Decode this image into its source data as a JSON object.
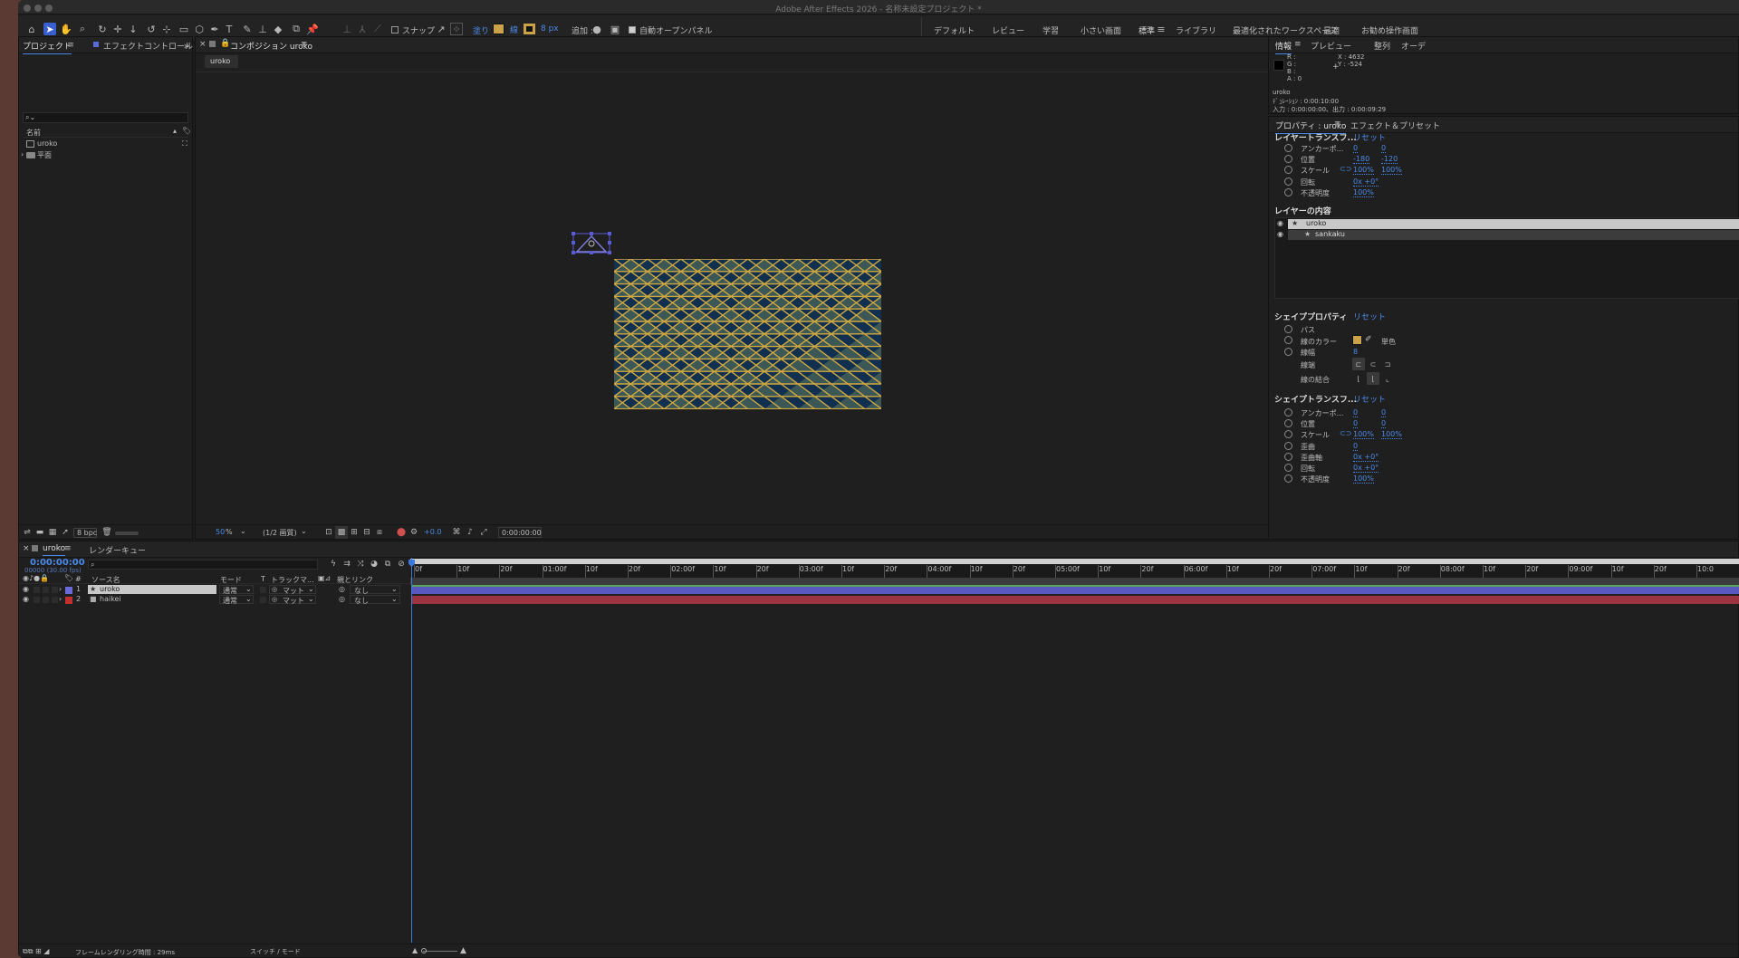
{
  "app_title": "Adobe After Effects 2026 - 名称未設定プロジェクト *",
  "toolbar": {
    "snap_label": "スナップ",
    "fill_label": "塗り",
    "stroke_width": "8 px",
    "add_label": "追加 :",
    "auto_open_label": "自動オープンパネル",
    "fill_color": "#c9a24a",
    "stroke_color": "#c9a24a"
  },
  "workspaces": [
    "デフォルト",
    "レビュー",
    "学習",
    "小さい画面",
    "標準",
    "ライブラリ",
    "最適化されたワークスペース",
    "最適",
    "お勧め操作画面"
  ],
  "project_panel": {
    "tab_project": "プロジェクト",
    "tab_effects": "エフェクトコントロール",
    "col_name": "名前",
    "items": [
      {
        "name": "uroko",
        "type": "composition"
      },
      {
        "name": "平面",
        "type": "folder"
      }
    ],
    "bpc": "8 bpc"
  },
  "comp_panel": {
    "tab_label": "コンポジション uroko",
    "breadcrumb": "uroko",
    "zoom": "50",
    "zoom_unit": "%",
    "resolution": "(1/2 画質)",
    "exposure": "+0.0",
    "timecode": "0:00:00:00",
    "pattern_bg": "#113050",
    "pattern_tri": "#3b5856",
    "pattern_line": "#d0a840"
  },
  "info_panel": {
    "tab_info": "情報",
    "tab_preview": "プレビュー",
    "tab_align": "整列",
    "tab_audio": "オーデ",
    "r": "R :",
    "g": "G :",
    "b": "B :",
    "a": "A : 0",
    "x": "X : 4632",
    "y": "Y : -524",
    "layer_name": "uroko",
    "duration": "ﾃﾞｭﾚｰｼｮﾝ : 0:00:10:00",
    "in_out": "入力 : 0:00:00:00、出力 : 0:00:09:29"
  },
  "properties_panel": {
    "tab_props": "プロパティ : uroko",
    "tab_effects": "エフェクト＆プリセット",
    "layer_transform": {
      "title": "レイヤートランスフ...",
      "reset": "リセット",
      "rows": [
        {
          "label": "アンカーポ...",
          "v1": "0",
          "v2": "0"
        },
        {
          "label": "位置",
          "v1": "-180",
          "v2": "-120"
        },
        {
          "label": "スケール",
          "v1": "100%",
          "v2": "100%"
        },
        {
          "label": "回転",
          "v1": "0x +0°",
          "v2": ""
        },
        {
          "label": "不透明度",
          "v1": "100%",
          "v2": ""
        }
      ]
    },
    "layer_contents": {
      "title": "レイヤーの内容",
      "items": [
        "uroko",
        "sankaku"
      ]
    },
    "shape_props": {
      "title": "シェイププロパティ",
      "reset": "リセット",
      "path": "パス",
      "stroke_color": "線のカラー",
      "stroke_mode": "単色",
      "stroke_width": "線幅",
      "stroke_width_val": "8",
      "line_cap": "線端",
      "line_join": "線の結合"
    },
    "shape_transform": {
      "title": "シェイプトランスフ...",
      "reset": "リセット",
      "rows": [
        {
          "label": "アンカーポ...",
          "v1": "0",
          "v2": "0"
        },
        {
          "label": "位置",
          "v1": "0",
          "v2": "0"
        },
        {
          "label": "スケール",
          "v1": "100%",
          "v2": "100%"
        },
        {
          "label": "歪曲",
          "v1": "0",
          "v2": ""
        },
        {
          "label": "歪曲軸",
          "v1": "0x +0°",
          "v2": ""
        },
        {
          "label": "回転",
          "v1": "0x +0°",
          "v2": ""
        },
        {
          "label": "不透明度",
          "v1": "100%",
          "v2": ""
        }
      ]
    }
  },
  "timeline": {
    "tab_comp": "uroko",
    "tab_render": "レンダーキュー",
    "timecode": "0:00:00:00",
    "frames": "00000 (30.00 fps)",
    "col_num": "#",
    "col_source": "ソース名",
    "col_mode": "モード",
    "col_t": "T",
    "col_track": "トラックマ...",
    "col_parent": "親とリンク",
    "layers": [
      {
        "num": "1",
        "name": "uroko",
        "mode": "通常",
        "matte": "マット",
        "parent": "なし",
        "color": "#6a6ad8"
      },
      {
        "num": "2",
        "name": "haikei",
        "mode": "通常",
        "matte": "マット",
        "parent": "なし",
        "color": "#c03030"
      }
    ],
    "ruler": [
      "0f",
      "10f",
      "20f",
      "01:00f",
      "10f",
      "20f",
      "02:00f",
      "10f",
      "20f",
      "03:00f",
      "10f",
      "20f",
      "04:00f",
      "10f",
      "20f",
      "05:00f",
      "10f",
      "20f",
      "06:00f",
      "10f",
      "20f",
      "07:00f",
      "10f",
      "20f",
      "08:00f",
      "10f",
      "20f",
      "09:00f",
      "10f",
      "20f",
      "10:0"
    ],
    "render_time": "フレームレンダリング時間 : 29ms",
    "switch_mode": "スイッチ / モード"
  }
}
